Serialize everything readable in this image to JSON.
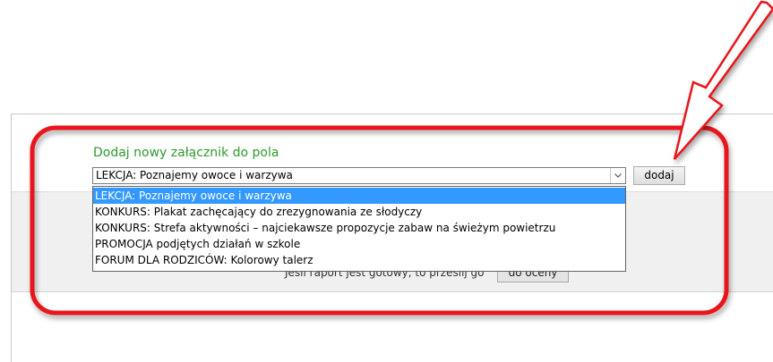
{
  "attachment": {
    "title": "Dodaj nowy załącznik do pola",
    "selected_value": "LEKCJA: Poznajemy owoce i warzywa",
    "add_button_label": "dodaj",
    "options": [
      "LEKCJA: Poznajemy owoce i warzywa",
      "KONKURS: Plakat zachęcający do zrezygnowania ze słodyczy",
      "KONKURS: Strefa aktywności – najciekawsze propozycje zabaw na świeżym powietrzu",
      "PROMOCJA podjętych działań w szkole",
      "FORUM DLA RODZICÓW: Kolorowy talerz"
    ],
    "selected_index": 0
  },
  "hidden_row": {
    "text": "Jeśli raport jest gotowy, to prześlij go",
    "button_label": "do oceny"
  },
  "colors": {
    "title_green": "#2e9a2e",
    "highlight_blue": "#3399ff",
    "annotation_red": "#e8151b"
  },
  "icons": {
    "dropdown_arrow": "chevron-down-icon",
    "annotation_arrow": "arrow-icon"
  }
}
